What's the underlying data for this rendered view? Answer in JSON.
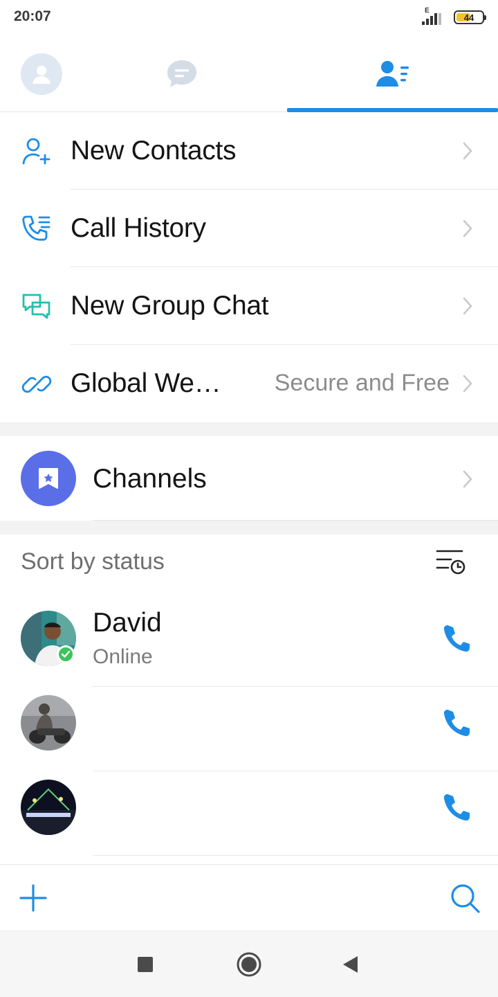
{
  "status_bar": {
    "time": "20:07",
    "network": "E",
    "battery": "44",
    "battery_color": "#f2c230"
  },
  "tabs": [
    {
      "name": "profile",
      "icon": "profile-avatar-icon",
      "active": false
    },
    {
      "name": "chats",
      "icon": "chat-bubble-icon",
      "active": false
    },
    {
      "name": "contacts",
      "icon": "contacts-icon",
      "active": true
    }
  ],
  "accent_color": "#1d8de6",
  "menu": {
    "new_contacts": {
      "label": "New Contacts",
      "icon": "add-person-icon"
    },
    "call_history": {
      "label": "Call History",
      "icon": "phone-list-icon"
    },
    "new_group_chat": {
      "label": "New Group Chat",
      "icon": "group-chat-icon"
    },
    "global_web": {
      "label": "Global We…",
      "sub": "Secure and Free",
      "icon": "link-icon"
    }
  },
  "channels": {
    "label": "Channels",
    "icon": "channel-bookmark-icon",
    "icon_bg": "#5a6ee8"
  },
  "sort": {
    "label": "Sort by status",
    "icon": "sort-by-time-icon"
  },
  "contacts": [
    {
      "name": "David",
      "status": "Online",
      "online": true
    },
    {
      "name": "",
      "status": "",
      "online": false
    },
    {
      "name": "",
      "status": "",
      "online": false
    }
  ],
  "actions": {
    "add_icon": "plus-icon",
    "search_icon": "search-icon"
  },
  "system_nav": [
    "recents-square-icon",
    "home-circle-icon",
    "back-triangle-icon"
  ]
}
